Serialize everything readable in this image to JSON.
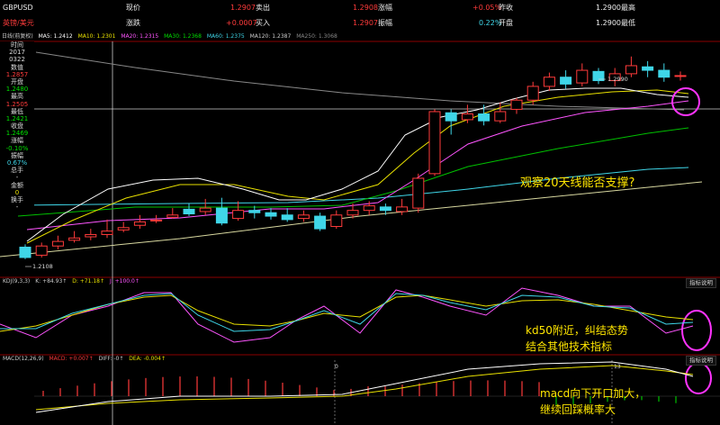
{
  "quote": {
    "symbol": "GBPUSD",
    "name": "英镑/美元",
    "row1": [
      {
        "label": "现价",
        "value": "1.2907",
        "color": "red",
        "unit": "卖出"
      },
      {
        "label2_value": "1.2908",
        "label2": "涨幅"
      },
      {
        "value3": "+0.05%",
        "label3": "昨收"
      },
      {
        "value4": "1.2900",
        "label4": "最高"
      }
    ],
    "labels": {
      "xianjia": "现价",
      "xianjia_val": "1.2907",
      "maichu": "卖出",
      "maichu_val": "1.2908",
      "zhangfu": "涨幅",
      "zhangfu_val": "+0.05%",
      "zuoshou": "昨收",
      "zuoshou_val": "1.2900",
      "zuigao": "最高",
      "zhangdie": "涨跌",
      "zhangdie_val": "+0.0007",
      "mairu": "买入",
      "mairu_val": "1.2907",
      "zhenfu": "振幅",
      "zhenfu_val": "0.22%",
      "kaipan": "开盘",
      "kaipan_val": "1.2900",
      "zuidi": "最低"
    }
  },
  "indicators_main": {
    "label": "日线(前复权)",
    "ma": [
      {
        "name": "MA5: 1.2412",
        "color": "#ffffff"
      },
      {
        "name": "MA10: 1.2301",
        "color": "#e8e000"
      },
      {
        "name": "MA20: 1.2315",
        "color": "#ff55ff"
      },
      {
        "name": "MA30: 1.2368",
        "color": "#00e000"
      },
      {
        "name": "MA60: 1.2375",
        "color": "#3fd6e8"
      },
      {
        "name": "MA120: 1.2387",
        "color": "#cccccc"
      },
      {
        "name": "MA250: 1.3068",
        "color": "#888888"
      }
    ]
  },
  "side_panel": [
    {
      "text": "时间",
      "color": "#ddd"
    },
    {
      "text": "2017",
      "color": "#ddd"
    },
    {
      "text": "0322",
      "color": "#ddd"
    },
    {
      "text": "数值",
      "color": "#ddd"
    },
    {
      "text": "1.2857",
      "color": "#ff3b3b"
    },
    {
      "text": "开盘",
      "color": "#ddd"
    },
    {
      "text": "1.2480",
      "color": "#00e000"
    },
    {
      "text": "最高",
      "color": "#ddd"
    },
    {
      "text": "1.2505",
      "color": "#ff3b3b"
    },
    {
      "text": "最低",
      "color": "#ddd"
    },
    {
      "text": "1.2421",
      "color": "#00e000"
    },
    {
      "text": "收盘",
      "color": "#ddd"
    },
    {
      "text": "1.2469",
      "color": "#00e000"
    },
    {
      "text": "涨幅",
      "color": "#ddd"
    },
    {
      "text": "-0.10%",
      "color": "#00e000"
    },
    {
      "text": "振幅",
      "color": "#ddd"
    },
    {
      "text": "0.67%",
      "color": "#3fd6e8"
    },
    {
      "text": "总手",
      "color": "#ddd"
    },
    {
      "text": "-",
      "color": "#ddd"
    },
    {
      "text": "金额",
      "color": "#ddd"
    },
    {
      "text": "0",
      "color": "#e8e000"
    },
    {
      "text": "换手",
      "color": "#ddd"
    },
    {
      "text": "-",
      "color": "#ddd"
    }
  ],
  "price_labels": {
    "high": "1.2990",
    "low": "1.2108"
  },
  "kdj": {
    "title": "KDJ(9,3,3)",
    "k": "K: +84.93↑",
    "d": "D: +71.18↑",
    "j": "J: +100.0↑",
    "button": "指标说明"
  },
  "macd": {
    "title": "MACD(12,26,9)",
    "macd": "MACD: +0.007↑",
    "diff": "DIFF: -0↑",
    "dea": "DEA: -0.004↑",
    "button": "指标说明",
    "zero_label": "0",
    "marker": "13"
  },
  "annotations": {
    "main": "观察20天线能否支撑?",
    "kdj_line1": "kd50附近，纠结态势",
    "kdj_line2": "结合其他技术指标",
    "macd_line1": "macd向下开口加大，",
    "macd_line2": "继续回踩概率大"
  },
  "chart_data": {
    "type": "candlestick",
    "candles": [
      {
        "o": 1.216,
        "c": 1.2115,
        "h": 1.2172,
        "l": 1.2108
      },
      {
        "o": 1.2125,
        "c": 1.2165,
        "h": 1.218,
        "l": 1.2115
      },
      {
        "o": 1.2165,
        "c": 1.2185,
        "h": 1.221,
        "l": 1.215
      },
      {
        "o": 1.219,
        "c": 1.22,
        "h": 1.223,
        "l": 1.218
      },
      {
        "o": 1.2205,
        "c": 1.2215,
        "h": 1.224,
        "l": 1.219
      },
      {
        "o": 1.2215,
        "c": 1.223,
        "h": 1.228,
        "l": 1.22
      },
      {
        "o": 1.2235,
        "c": 1.2245,
        "h": 1.227,
        "l": 1.2225
      },
      {
        "o": 1.2255,
        "c": 1.227,
        "h": 1.23,
        "l": 1.224
      },
      {
        "o": 1.2275,
        "c": 1.2278,
        "h": 1.23,
        "l": 1.2265
      },
      {
        "o": 1.229,
        "c": 1.23,
        "h": 1.233,
        "l": 1.2285
      },
      {
        "o": 1.2325,
        "c": 1.2305,
        "h": 1.235,
        "l": 1.2295
      },
      {
        "o": 1.2315,
        "c": 1.233,
        "h": 1.237,
        "l": 1.23
      },
      {
        "o": 1.233,
        "c": 1.2265,
        "h": 1.2375,
        "l": 1.2255
      },
      {
        "o": 1.2285,
        "c": 1.232,
        "h": 1.236,
        "l": 1.2275
      },
      {
        "o": 1.232,
        "c": 1.231,
        "h": 1.234,
        "l": 1.2285
      },
      {
        "o": 1.231,
        "c": 1.2295,
        "h": 1.233,
        "l": 1.228
      },
      {
        "o": 1.23,
        "c": 1.228,
        "h": 1.233,
        "l": 1.227
      },
      {
        "o": 1.2285,
        "c": 1.23,
        "h": 1.232,
        "l": 1.227
      },
      {
        "o": 1.2295,
        "c": 1.224,
        "h": 1.231,
        "l": 1.223
      },
      {
        "o": 1.225,
        "c": 1.23,
        "h": 1.232,
        "l": 1.224
      },
      {
        "o": 1.23,
        "c": 1.232,
        "h": 1.235,
        "l": 1.2285
      },
      {
        "o": 1.232,
        "c": 1.234,
        "h": 1.236,
        "l": 1.23
      },
      {
        "o": 1.2335,
        "c": 1.232,
        "h": 1.235,
        "l": 1.23
      },
      {
        "o": 1.2315,
        "c": 1.2335,
        "h": 1.237,
        "l": 1.23
      },
      {
        "o": 1.233,
        "c": 1.246,
        "h": 1.248,
        "l": 1.231
      },
      {
        "o": 1.248,
        "c": 1.275,
        "h": 1.276,
        "l": 1.247
      },
      {
        "o": 1.2745,
        "c": 1.271,
        "h": 1.276,
        "l": 1.265
      },
      {
        "o": 1.2715,
        "c": 1.274,
        "h": 1.278,
        "l": 1.27
      },
      {
        "o": 1.274,
        "c": 1.271,
        "h": 1.278,
        "l": 1.269
      },
      {
        "o": 1.271,
        "c": 1.275,
        "h": 1.279,
        "l": 1.27
      },
      {
        "o": 1.276,
        "c": 1.28,
        "h": 1.281,
        "l": 1.274
      },
      {
        "o": 1.28,
        "c": 1.286,
        "h": 1.288,
        "l": 1.278
      },
      {
        "o": 1.286,
        "c": 1.29,
        "h": 1.292,
        "l": 1.284
      },
      {
        "o": 1.29,
        "c": 1.287,
        "h": 1.293,
        "l": 1.285
      },
      {
        "o": 1.2875,
        "c": 1.293,
        "h": 1.296,
        "l": 1.286
      },
      {
        "o": 1.2925,
        "c": 1.2885,
        "h": 1.294,
        "l": 1.287
      },
      {
        "o": 1.2885,
        "c": 1.2915,
        "h": 1.294,
        "l": 1.286
      },
      {
        "o": 1.2915,
        "c": 1.295,
        "h": 1.299,
        "l": 1.29
      },
      {
        "o": 1.2945,
        "c": 1.293,
        "h": 1.297,
        "l": 1.29
      },
      {
        "o": 1.293,
        "c": 1.29,
        "h": 1.296,
        "l": 1.288
      },
      {
        "o": 1.2905,
        "c": 1.2907,
        "h": 1.2925,
        "l": 1.2885
      }
    ],
    "ylim": [
      1.206,
      1.304
    ]
  }
}
